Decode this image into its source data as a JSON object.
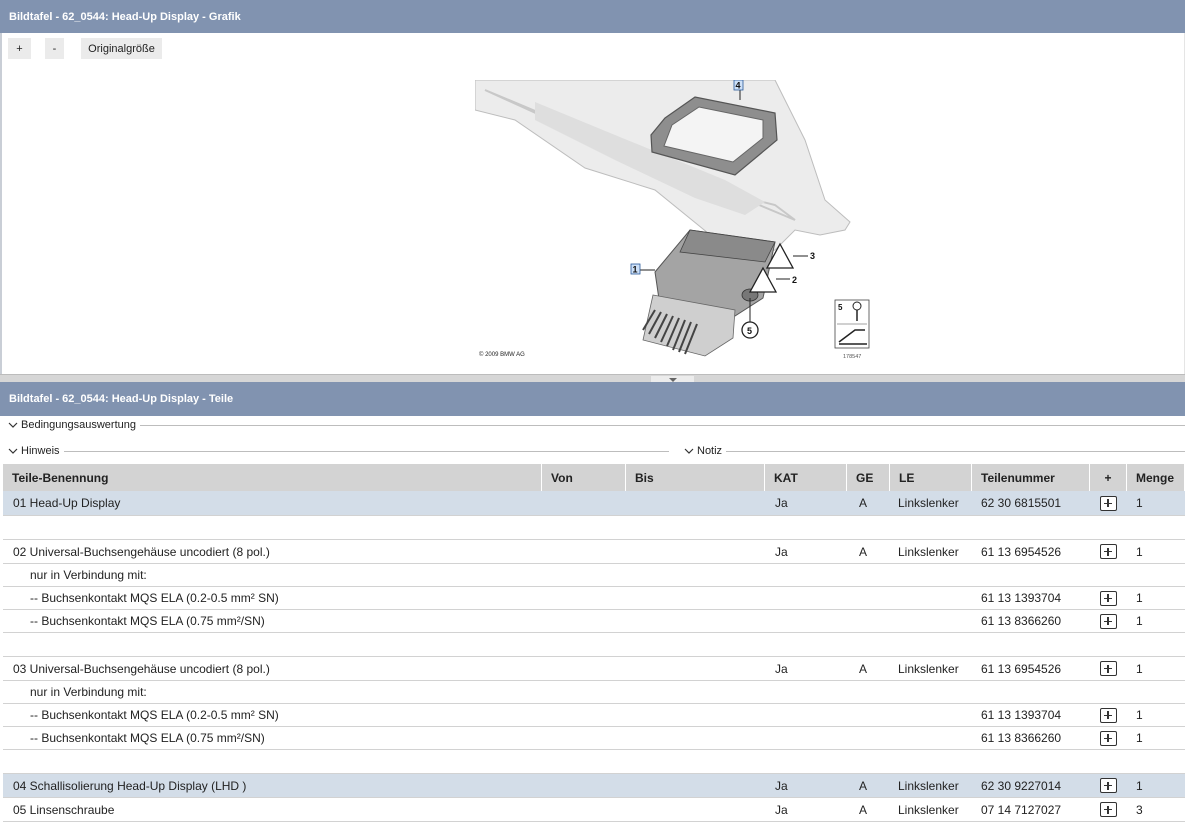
{
  "grafik_panel": {
    "title": "Bildtafel - 62_0544: Head-Up Display - Grafik",
    "toolbar": {
      "zoom_in": "+",
      "zoom_out": "-",
      "original_size": "Originalgröße"
    },
    "illustration": {
      "copyright": "© 2009 BMW AG",
      "image_number": "178547",
      "callouts": [
        "1",
        "2",
        "3",
        "4",
        "5"
      ],
      "legend_label": "5"
    }
  },
  "teile_panel": {
    "title": "Bildtafel - 62_0544: Head-Up Display - Teile",
    "sections": {
      "bedingungen": "Bedingungsauswertung",
      "hinweis": "Hinweis",
      "notiz": "Notiz"
    },
    "columns": {
      "name": "Teile-Benennung",
      "von": "Von",
      "bis": "Bis",
      "kat": "KAT",
      "ge": "GE",
      "le": "LE",
      "nr": "Teilenummer",
      "plus": "+",
      "menge": "Menge"
    },
    "rows": [
      {
        "type": "main",
        "hl": true,
        "name": "01 Head-Up Display",
        "kat": "Ja",
        "ge": "A",
        "le": "Linkslenker",
        "nr": "62 30 6815501",
        "cart": true,
        "menge": "1"
      },
      {
        "type": "blank"
      },
      {
        "type": "main",
        "hl": false,
        "name": "02 Universal-Buchsengehäuse uncodiert (8 pol.)",
        "kat": "Ja",
        "ge": "A",
        "le": "Linkslenker",
        "nr": "61 13 6954526",
        "cart": true,
        "menge": "1"
      },
      {
        "type": "sub",
        "name": "nur in Verbindung mit:"
      },
      {
        "type": "sub",
        "name": "-- Buchsenkontakt MQS ELA (0.2-0.5 mm² SN)",
        "nr": "61 13 1393704",
        "cart": true,
        "menge": "1"
      },
      {
        "type": "sub",
        "name": "-- Buchsenkontakt MQS ELA (0.75 mm²/SN)",
        "nr": "61 13 8366260",
        "cart": true,
        "menge": "1"
      },
      {
        "type": "blank"
      },
      {
        "type": "main",
        "hl": false,
        "name": "03 Universal-Buchsengehäuse uncodiert (8 pol.)",
        "kat": "Ja",
        "ge": "A",
        "le": "Linkslenker",
        "nr": "61 13 6954526",
        "cart": true,
        "menge": "1"
      },
      {
        "type": "sub",
        "name": "nur in Verbindung mit:"
      },
      {
        "type": "sub",
        "name": "-- Buchsenkontakt MQS ELA (0.2-0.5 mm² SN)",
        "nr": "61 13 1393704",
        "cart": true,
        "menge": "1"
      },
      {
        "type": "sub",
        "name": "-- Buchsenkontakt MQS ELA (0.75 mm²/SN)",
        "nr": "61 13 8366260",
        "cart": true,
        "menge": "1"
      },
      {
        "type": "blank"
      },
      {
        "type": "main",
        "hl": true,
        "name": "04 Schallisolierung Head-Up Display (LHD )",
        "kat": "Ja",
        "ge": "A",
        "le": "Linkslenker",
        "nr": "62 30 9227014",
        "cart": true,
        "menge": "1"
      },
      {
        "type": "main",
        "hl": false,
        "name": "05 Linsenschraube",
        "kat": "Ja",
        "ge": "A",
        "le": "Linkslenker",
        "nr": "07 14 7127027",
        "cart": true,
        "menge": "3"
      }
    ]
  }
}
